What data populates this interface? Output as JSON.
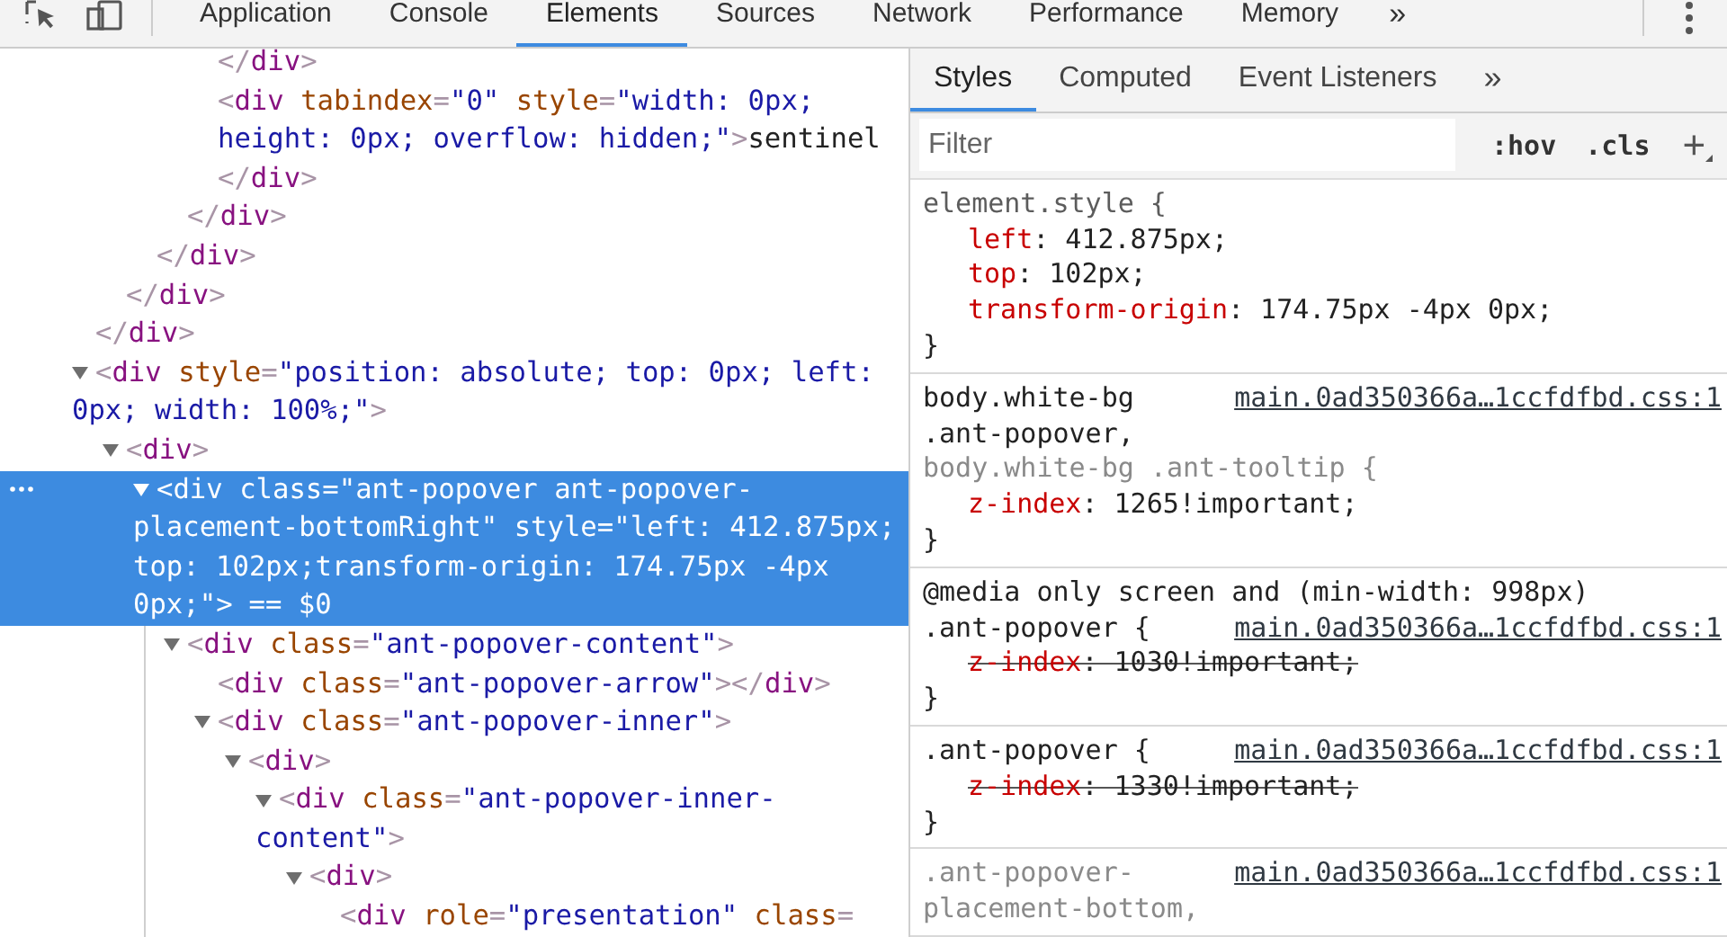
{
  "toolbar": {
    "tabs": [
      {
        "label": "Application",
        "selected": false
      },
      {
        "label": "Console",
        "selected": false
      },
      {
        "label": "Elements",
        "selected": true
      },
      {
        "label": "Sources",
        "selected": false
      },
      {
        "label": "Network",
        "selected": false
      },
      {
        "label": "Performance",
        "selected": false
      },
      {
        "label": "Memory",
        "selected": false
      }
    ],
    "overflow": "»"
  },
  "elements_tree": {
    "nodes": [
      {
        "kind": "tail",
        "selected": false,
        "close": "</div>",
        "children": [
          {
            "kind": "tail",
            "selected": false,
            "close": "</div>",
            "children": [
              {
                "kind": "tail",
                "selected": false,
                "close": "</div>",
                "children": [
                  {
                    "kind": "tail",
                    "selected": false,
                    "close": "</div>",
                    "children": [
                      {
                        "kind": "tail",
                        "selected": false,
                        "close": "</div>"
                      },
                      {
                        "kind": "element",
                        "selected": false,
                        "lines": [
                          "<div tabindex=\"0\" style=\"width: 0px;",
                          "height: 0px; overflow: hidden;\">sentinel",
                          "</div>"
                        ]
                      }
                    ]
                  }
                ]
              }
            ]
          }
        ]
      },
      {
        "kind": "element",
        "selected": false,
        "expanded": true,
        "lines": [
          "<div style=\"position: absolute; top: 0px; left:",
          "0px; width: 100%;\">"
        ],
        "children": [
          {
            "kind": "element",
            "selected": false,
            "expanded": true,
            "lines": [
              "<div>"
            ],
            "children": [
              {
                "kind": "element",
                "selected": true,
                "expanded": true,
                "console_ref": "== $0",
                "lines": [
                  "<div class=\"ant-popover ant-popover-",
                  "placement-bottomRight\" style=\"left: 412.875px;",
                  "top: 102px;transform-origin: 174.75px -4px",
                  "0px;\">"
                ],
                "children": [
                  {
                    "kind": "element",
                    "selected": false,
                    "expanded": true,
                    "lines": [
                      "<div class=\"ant-popover-content\">"
                    ],
                    "children": [
                      {
                        "kind": "element",
                        "selected": false,
                        "lines": [
                          "<div class=\"ant-popover-arrow\"></div>"
                        ]
                      },
                      {
                        "kind": "element",
                        "selected": false,
                        "expanded": true,
                        "lines": [
                          "<div class=\"ant-popover-inner\">"
                        ],
                        "children": [
                          {
                            "kind": "element",
                            "selected": false,
                            "expanded": true,
                            "lines": [
                              "<div>"
                            ],
                            "children": [
                              {
                                "kind": "element",
                                "selected": false,
                                "expanded": true,
                                "lines": [
                                  "<div class=\"ant-popover-inner-",
                                  "content\">"
                                ],
                                "children": [
                                  {
                                    "kind": "element",
                                    "selected": false,
                                    "expanded": true,
                                    "lines": [
                                      "<div>"
                                    ],
                                    "children": [
                                      {
                                        "kind": "element",
                                        "selected": false,
                                        "lines": [
                                          "<div role=\"presentation\" class="
                                        ]
                                      }
                                    ]
                                  }
                                ]
                              }
                            ]
                          }
                        ]
                      }
                    ]
                  }
                ]
              }
            ]
          }
        ]
      }
    ]
  },
  "sidebar_tabs": {
    "tabs": [
      {
        "label": "Styles",
        "selected": true
      },
      {
        "label": "Computed",
        "selected": false
      },
      {
        "label": "Event Listeners",
        "selected": false
      }
    ],
    "overflow": "»"
  },
  "styles_filter": {
    "placeholder": "Filter",
    "hov": ":hov",
    "cls": ".cls",
    "add": "+"
  },
  "rules": [
    {
      "kind": "inline",
      "selectors": [
        {
          "text": "element.style {",
          "matched": true
        }
      ],
      "declarations": [
        {
          "property": "left",
          "rest": ": 412.875px;",
          "overridden": false
        },
        {
          "property": "top",
          "rest": ": 102px;",
          "overridden": false
        },
        {
          "property": "transform-origin",
          "rest": ": 174.75px -4px 0px;",
          "overridden": false
        }
      ],
      "close": "}"
    },
    {
      "kind": "stylesheet",
      "source": "main.0ad350366a…1ccfdfbd.css:1",
      "selectors": [
        {
          "text": "body.white-bg",
          "matched": true
        },
        {
          "text": ".ant-popover,",
          "matched": true
        },
        {
          "text": "body.white-bg .ant-tooltip {",
          "matched": false
        }
      ],
      "declarations": [
        {
          "property": "z-index",
          "rest": ": 1265!important;",
          "overridden": false
        }
      ],
      "close": "}"
    },
    {
      "kind": "stylesheet",
      "media": "@media only screen and (min-width: 998px)",
      "source": "main.0ad350366a…1ccfdfbd.css:1",
      "selectors": [
        {
          "text": ".ant-popover {",
          "matched": true
        }
      ],
      "declarations": [
        {
          "property": "z-index",
          "rest": ": 1030!important;",
          "overridden": true
        }
      ],
      "close": "}"
    },
    {
      "kind": "stylesheet",
      "source": "main.0ad350366a…1ccfdfbd.css:1",
      "selectors": [
        {
          "text": ".ant-popover {",
          "matched": true
        }
      ],
      "declarations": [
        {
          "property": "z-index",
          "rest": ": 1330!important;",
          "overridden": true
        }
      ],
      "close": "}"
    },
    {
      "kind": "stylesheet",
      "source": "main.0ad350366a…1ccfdfbd.css:1",
      "selectors": [
        {
          "text": ".ant-popover-",
          "matched": false
        },
        {
          "text": "placement-bottom,",
          "matched": false
        }
      ]
    }
  ]
}
